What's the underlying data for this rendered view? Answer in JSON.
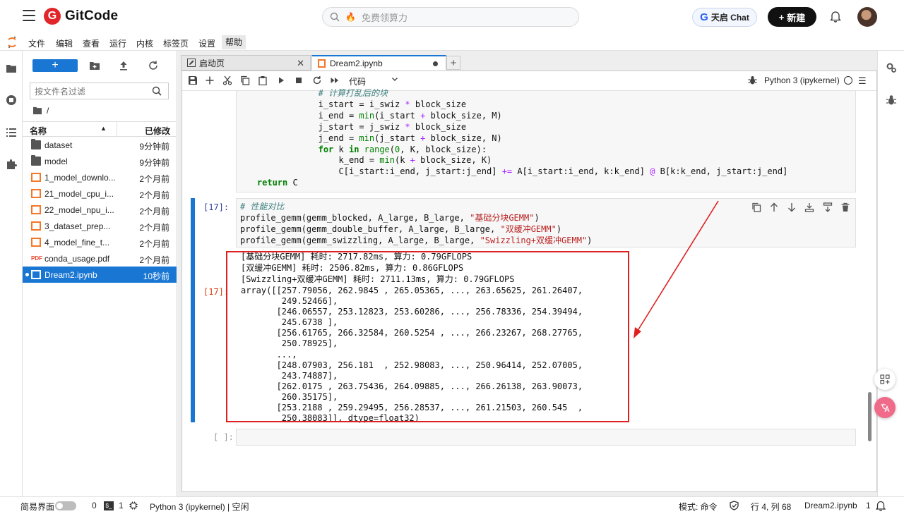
{
  "topbar": {
    "logo_text": "GitCode",
    "search_placeholder": "免费领算力",
    "chat_label": "天启 Chat",
    "new_label": "新建"
  },
  "menu": [
    "文件",
    "编辑",
    "查看",
    "运行",
    "内核",
    "标签页",
    "设置",
    "帮助"
  ],
  "filebrowser": {
    "filter_placeholder": "按文件名过滤",
    "path": "/",
    "col_name": "名称",
    "col_modified": "已修改",
    "items": [
      {
        "name": "dataset",
        "modified": "9分钟前",
        "type": "folder"
      },
      {
        "name": "model",
        "modified": "9分钟前",
        "type": "folder"
      },
      {
        "name": "1_model_downlo...",
        "modified": "2个月前",
        "type": "notebook"
      },
      {
        "name": "21_model_cpu_i...",
        "modified": "2个月前",
        "type": "notebook"
      },
      {
        "name": "22_model_npu_i...",
        "modified": "2个月前",
        "type": "notebook"
      },
      {
        "name": "3_dataset_prep...",
        "modified": "2个月前",
        "type": "notebook"
      },
      {
        "name": "4_model_fine_t...",
        "modified": "2个月前",
        "type": "notebook"
      },
      {
        "name": "conda_usage.pdf",
        "modified": "2个月前",
        "type": "pdf"
      },
      {
        "name": "Dream2.ipynb",
        "modified": "10秒前",
        "type": "notebook",
        "selected": true
      }
    ]
  },
  "tabs": [
    {
      "label": "启动页",
      "active": false
    },
    {
      "label": "Dream2.ipynb",
      "active": true
    }
  ],
  "toolbar": {
    "cell_type": "代码",
    "kernel": "Python 3 (ipykernel)"
  },
  "cells": {
    "cell2_prompt": "[17]:",
    "out_prompt": "[17]:",
    "empty_prompt": "[ ]:",
    "stream_lines": [
      "[基础分块GEMM] 耗时: 2717.82ms, 算力: 0.79GFLOPS",
      "[双缓冲GEMM] 耗时: 2506.82ms, 算力: 0.86GFLOPS",
      "[Swizzling+双缓冲GEMM] 耗时: 2711.13ms, 算力: 0.79GFLOPS"
    ],
    "result_lines": [
      "array([[257.79056, 262.9845 , 265.05365, ..., 263.65625, 261.26407,",
      "        249.52466],",
      "       [246.06557, 253.12823, 253.60286, ..., 256.78336, 254.39494,",
      "        245.6738 ],",
      "       [256.61765, 266.32584, 260.5254 , ..., 266.23267, 268.27765,",
      "        250.78925],",
      "       ...,",
      "       [248.07903, 256.181  , 252.98083, ..., 250.96414, 252.07005,",
      "        243.74887],",
      "       [262.0175 , 263.75436, 264.09885, ..., 266.26138, 263.90073,",
      "        260.35175],",
      "       [253.2188 , 259.29495, 256.28537, ..., 261.21503, 260.545  ,",
      "        250.38083]], dtype=float32)"
    ]
  },
  "statusbar": {
    "simple_mode": "简易界面",
    "count_a": "0",
    "count_b": "1",
    "kernel_status": "Python 3 (ipykernel) | 空闲",
    "mode": "模式: 命令",
    "position": "行 4, 列 68",
    "filename": "Dream2.ipynb",
    "notif_count": "1"
  },
  "colors": {
    "accent": "#1976d2",
    "jupyter_orange": "#f37726",
    "annotation_red": "#e02020"
  }
}
